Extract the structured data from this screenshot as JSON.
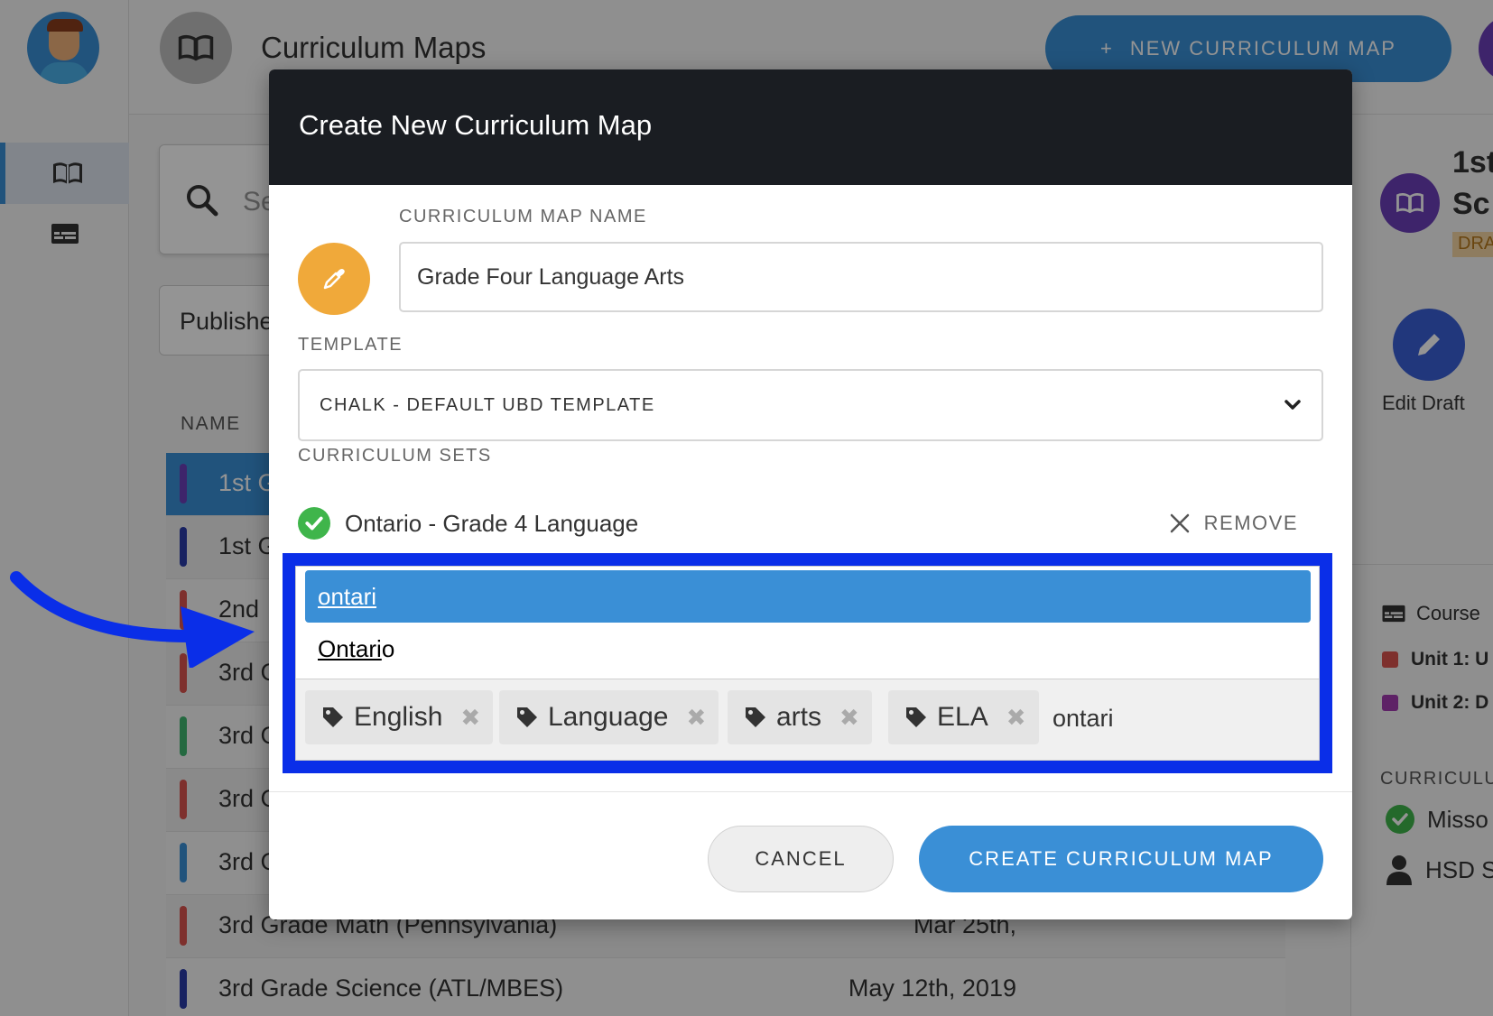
{
  "app": {
    "page_title": "Curriculum Maps",
    "new_map_label": "NEW CURRICULUM MAP",
    "new_map_plus": "+"
  },
  "nav": {
    "items": [
      {
        "icon": "book-icon",
        "active": true
      },
      {
        "icon": "course-card-icon",
        "active": false
      }
    ]
  },
  "list": {
    "search_placeholder": "Se",
    "filter_value": "Publishe",
    "column_name": "NAME",
    "rows": [
      {
        "name": "1st G",
        "date": "",
        "color": "#6b3fb8",
        "selected": true
      },
      {
        "name": "1st G",
        "date": "",
        "color": "#2a3ba8",
        "selected": false
      },
      {
        "name": "2nd",
        "date": "",
        "color": "#d9534f",
        "selected": false
      },
      {
        "name": "3rd G",
        "date": "",
        "color": "#d9534f",
        "selected": false
      },
      {
        "name": "3rd G",
        "date": "",
        "color": "#3fb56f",
        "selected": false
      },
      {
        "name": "3rd G",
        "date": "",
        "color": "#d9534f",
        "selected": false
      },
      {
        "name": "3rd G",
        "date": "",
        "color": "#3a8fd6",
        "selected": false
      },
      {
        "name": "3rd Grade Math (Pennsylvania)",
        "date": "Mar 25th,",
        "color": "#d9534f",
        "selected": false
      },
      {
        "name": "3rd Grade Science (ATL/MBES)",
        "date": "May 12th, 2019",
        "color": "#2a3ba8",
        "selected": false
      }
    ]
  },
  "right_panel": {
    "title_line1": "1st",
    "title_line2": "Sc",
    "status": "DRA",
    "edit_label": "Edit Draft",
    "course_label": "Course",
    "units": [
      {
        "label": "Unit 1: U",
        "color": "#d9534f"
      },
      {
        "label": "Unit 2: D",
        "color": "#a23bb0"
      }
    ],
    "section_title": "CURRICULU",
    "set_name": "Misso",
    "owner": "HSD S"
  },
  "modal": {
    "title": "Create New Curriculum Map",
    "name_label": "CURRICULUM MAP NAME",
    "name_value": "Grade Four Language Arts",
    "template_label": "TEMPLATE",
    "template_value": "CHALK - DEFAULT UBD TEMPLATE",
    "sets_label": "CURRICULUM SETS",
    "selected_set": "Ontario - Grade 4 Language",
    "remove_label": "REMOVE",
    "suggestions": [
      {
        "text": "ontari",
        "active": true
      },
      {
        "text_match": "Ontari",
        "text_rest": "o",
        "active": false
      }
    ],
    "tags": [
      "English",
      "Language",
      "arts",
      "ELA"
    ],
    "tag_remove_glyph": "✖",
    "tag_input_value": "ontari",
    "cancel_label": "CANCEL",
    "create_label": "CREATE CURRICULUM MAP"
  },
  "colors": {
    "accent": "#3a8fd6",
    "header": "#1a1d22",
    "highlight": "#0a2ee8",
    "icon_picker": "#f0a93a",
    "success": "#3fb54b"
  }
}
